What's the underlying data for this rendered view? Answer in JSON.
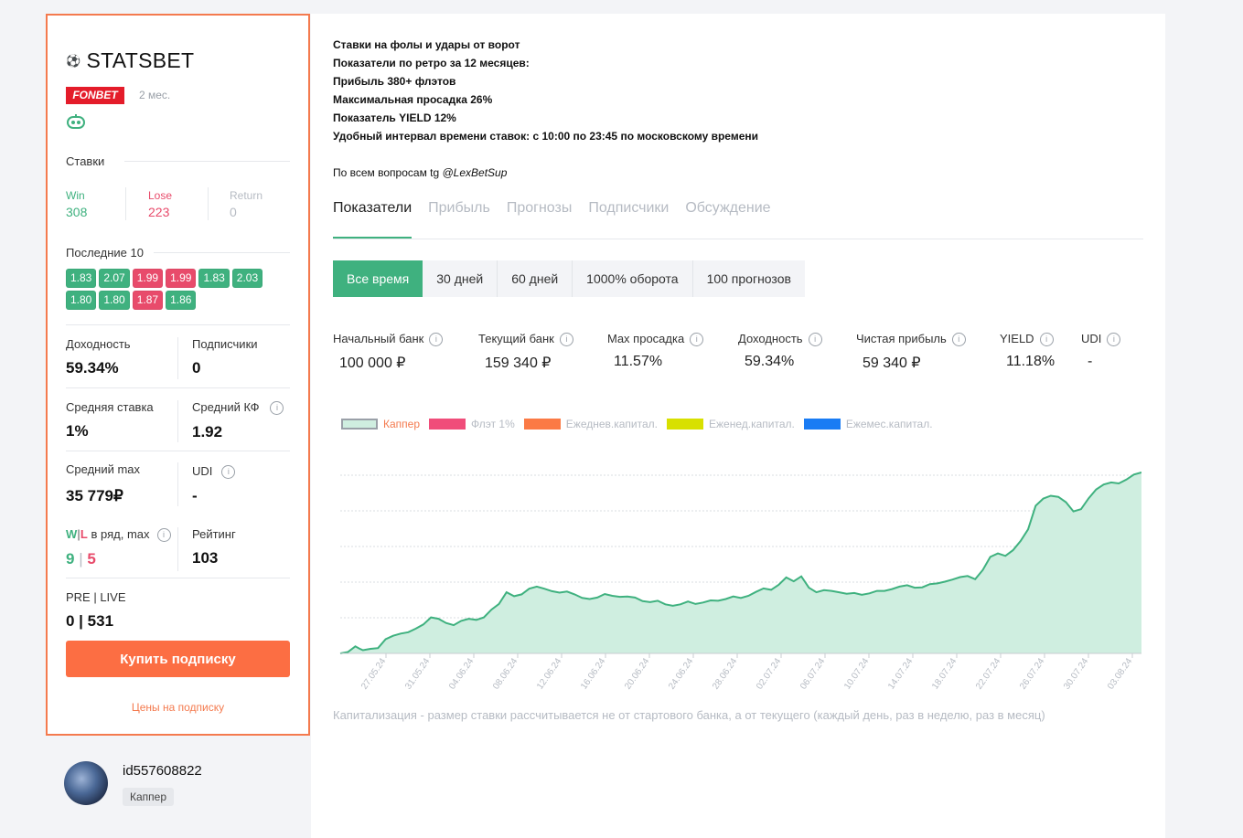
{
  "capper": {
    "name": "STATSBET",
    "ball_icon": "soccer-ball-icon",
    "bookmaker": "FONBET",
    "age": "2 мес.",
    "bets_label": "Ставки",
    "win_label": "Win",
    "win": "308",
    "lose_label": "Lose",
    "lose": "223",
    "return_label": "Return",
    "return": "0",
    "last10_label": "Последние 10",
    "last10": [
      {
        "v": "1.83",
        "r": "win"
      },
      {
        "v": "2.07",
        "r": "win"
      },
      {
        "v": "1.99",
        "r": "lose"
      },
      {
        "v": "1.99",
        "r": "lose"
      },
      {
        "v": "1.83",
        "r": "win"
      },
      {
        "v": "2.03",
        "r": "win"
      },
      {
        "v": "1.80",
        "r": "win"
      },
      {
        "v": "1.80",
        "r": "win"
      },
      {
        "v": "1.87",
        "r": "lose"
      },
      {
        "v": "1.86",
        "r": "win"
      }
    ],
    "yield_label": "Доходность",
    "yield": "59.34%",
    "subs_label": "Подписчики",
    "subs": "0",
    "avg_stake_label": "Средняя ставка",
    "avg_stake": "1%",
    "avg_kf_label": "Средний КФ",
    "avg_kf": "1.92",
    "avg_max_label": "Средний max",
    "avg_max": "35 779₽",
    "udi_label": "UDI",
    "udi": "-",
    "wl_w": "W",
    "wl_sep": "|",
    "wl_l": "L",
    "wl_rest": "в ряд, max",
    "wl_win": "9",
    "wl_value_sep": "|",
    "wl_lose": "5",
    "rating_label": "Рейтинг",
    "rating": "103",
    "prelive_label": "PRE | LIVE",
    "prelive": "0 | 531",
    "buy_label": "Купить подписку",
    "prices_label": "Цены на подписку"
  },
  "user": {
    "id": "id557608822",
    "role": "Каппер"
  },
  "description": {
    "lines": [
      "Ставки на фолы и удары от ворот",
      "Показатели по ретро за 12 месяцев:",
      "Прибыль 380+ флэтов",
      "Максимальная просадка 26%",
      "Показатель YIELD 12%",
      "Удобный интервал времени ставок: с 10:00 по 23:45 по московскому времени"
    ],
    "contact_prefix": "По всем вопросам tg",
    "contact_handle": "@LexBetSup"
  },
  "tabs": [
    "Показатели",
    "Прибыль",
    "Прогнозы",
    "Подписчики",
    "Обсуждение"
  ],
  "periods": [
    "Все время",
    "30 дней",
    "60 дней",
    "1000% оборота",
    "100 прогнозов"
  ],
  "metrics": [
    {
      "label": "Начальный банк",
      "value": "100 000 ₽"
    },
    {
      "label": "Текущий банк",
      "value": "159 340 ₽"
    },
    {
      "label": "Max просадка",
      "value": "11.57%"
    },
    {
      "label": "Доходность",
      "value": "59.34%"
    },
    {
      "label": "Чистая прибыль",
      "value": "59 340 ₽"
    },
    {
      "label": "YIELD",
      "value": "11.18%"
    },
    {
      "label": "UDI",
      "value": "-"
    }
  ],
  "legend": [
    {
      "name": "Каппер",
      "color": "#cfeee0",
      "active": true
    },
    {
      "name": "Флэт 1%",
      "color": "#f04d7a",
      "active": false
    },
    {
      "name": "Ежеднев.капитал.",
      "color": "#fb7a45",
      "active": false
    },
    {
      "name": "Еженед.капитал.",
      "color": "#d8e000",
      "active": false
    },
    {
      "name": "Ежемес.капитал.",
      "color": "#1a7cf4",
      "active": false
    }
  ],
  "colors": {
    "accent": "#3fb17f",
    "orange": "#fc6e43",
    "lose": "#e84b6b"
  },
  "chart_note": "Капитализация - размер ставки рассчитывается не от стартового банка, а от текущего (каждый день, раз в неделю, раз в месяц)",
  "chart_data": {
    "type": "area",
    "series_name": "Каппер",
    "x_ticks": [
      "27.05.24",
      "31.05.24",
      "04.06.24",
      "08.06.24",
      "12.06.24",
      "16.06.24",
      "20.06.24",
      "24.06.24",
      "28.06.24",
      "02.07.24",
      "06.07.24",
      "10.07.24",
      "14.07.24",
      "18.07.24",
      "22.07.24",
      "26.07.24",
      "30.07.24",
      "03.08.24"
    ],
    "ylim": [
      100000,
      160000
    ],
    "grid": true,
    "points": [
      [
        0,
        100000
      ],
      [
        1,
        100400
      ],
      [
        2,
        102000
      ],
      [
        2.5,
        101400
      ],
      [
        3,
        100900
      ],
      [
        4,
        101300
      ],
      [
        5,
        101500
      ],
      [
        6,
        104000
      ],
      [
        7,
        105000
      ],
      [
        8,
        105600
      ],
      [
        9,
        106000
      ],
      [
        10,
        107000
      ],
      [
        11,
        108200
      ],
      [
        12,
        110200
      ],
      [
        13,
        109800
      ],
      [
        14,
        108600
      ],
      [
        15,
        108000
      ],
      [
        16,
        109200
      ],
      [
        17,
        109800
      ],
      [
        18,
        109500
      ],
      [
        19,
        110200
      ],
      [
        20,
        112400
      ],
      [
        21,
        114000
      ],
      [
        22,
        117300
      ],
      [
        23,
        116200
      ],
      [
        24,
        116700
      ],
      [
        25,
        118300
      ],
      [
        26,
        118900
      ],
      [
        27,
        118300
      ],
      [
        28,
        117600
      ],
      [
        29,
        117200
      ],
      [
        30,
        117500
      ],
      [
        31,
        116700
      ],
      [
        32,
        115700
      ],
      [
        33,
        115400
      ],
      [
        34,
        115800
      ],
      [
        35,
        116800
      ],
      [
        36,
        116300
      ],
      [
        37,
        116000
      ],
      [
        38,
        116100
      ],
      [
        39,
        115800
      ],
      [
        40,
        114800
      ],
      [
        41,
        114500
      ],
      [
        42,
        114900
      ],
      [
        43,
        113900
      ],
      [
        44,
        113500
      ],
      [
        45,
        113900
      ],
      [
        46,
        114700
      ],
      [
        47,
        114000
      ],
      [
        48,
        114400
      ],
      [
        49,
        115000
      ],
      [
        50,
        114900
      ],
      [
        51,
        115400
      ],
      [
        52,
        116100
      ],
      [
        53,
        115700
      ],
      [
        54,
        116300
      ],
      [
        55,
        117400
      ],
      [
        56,
        118400
      ],
      [
        57,
        118000
      ],
      [
        58,
        119400
      ],
      [
        59,
        121500
      ],
      [
        60,
        120400
      ],
      [
        61,
        121800
      ],
      [
        62,
        118600
      ],
      [
        63,
        117300
      ],
      [
        64,
        117900
      ],
      [
        65,
        117700
      ],
      [
        66,
        117300
      ],
      [
        67,
        116900
      ],
      [
        68,
        117100
      ],
      [
        69,
        116600
      ],
      [
        70,
        117000
      ],
      [
        71,
        117700
      ],
      [
        72,
        117700
      ],
      [
        73,
        118200
      ],
      [
        74,
        118900
      ],
      [
        75,
        119300
      ],
      [
        76,
        118600
      ],
      [
        77,
        118700
      ],
      [
        78,
        119600
      ],
      [
        79,
        119800
      ],
      [
        80,
        120300
      ],
      [
        81,
        120900
      ],
      [
        82,
        121600
      ],
      [
        83,
        121900
      ],
      [
        84,
        121000
      ],
      [
        85,
        123600
      ],
      [
        86,
        127300
      ],
      [
        87,
        128300
      ],
      [
        88,
        127600
      ],
      [
        89,
        129200
      ],
      [
        90,
        131800
      ],
      [
        91,
        135100
      ],
      [
        92,
        141800
      ],
      [
        93,
        143800
      ],
      [
        94,
        144600
      ],
      [
        95,
        144300
      ],
      [
        96,
        142800
      ],
      [
        97,
        140200
      ],
      [
        98,
        140800
      ],
      [
        99,
        143900
      ],
      [
        100,
        146400
      ],
      [
        101,
        147800
      ],
      [
        102,
        148400
      ],
      [
        103,
        148100
      ],
      [
        104,
        149200
      ],
      [
        105,
        150600
      ],
      [
        106,
        151200
      ]
    ]
  }
}
